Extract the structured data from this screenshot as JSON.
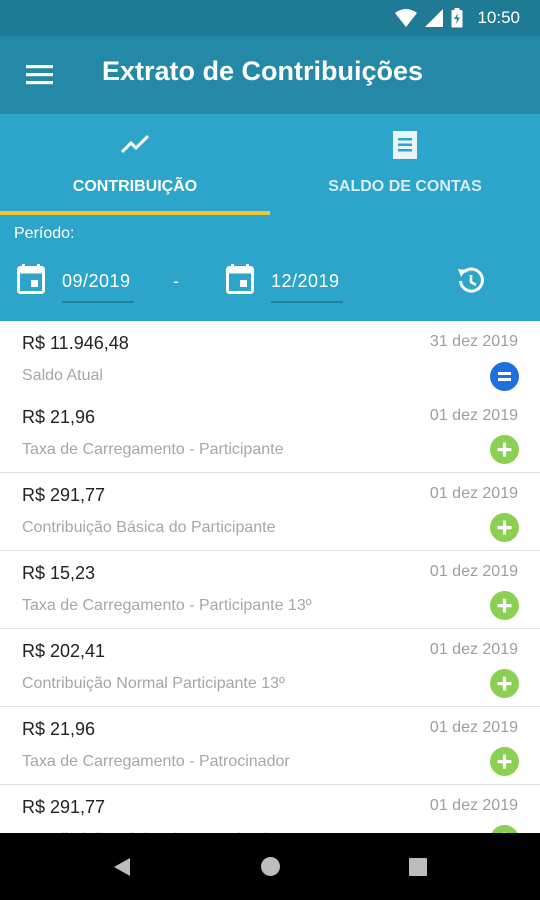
{
  "status_bar": {
    "time": "10:50"
  },
  "app_bar": {
    "title": "Extrato de Contribuições"
  },
  "tabs": [
    {
      "label": "CONTRIBUIÇÃO",
      "icon": "trending-line-icon",
      "active": true
    },
    {
      "label": "SALDO DE CONTAS",
      "icon": "receipt-icon",
      "active": false
    }
  ],
  "period": {
    "label": "Período:",
    "start": "09/2019",
    "separator": "-",
    "end": "12/2019"
  },
  "entries": [
    {
      "amount": "R$ 11.946,48",
      "date": "31 dez 2019",
      "description": "Saldo Atual",
      "icon": "equals-icon"
    },
    {
      "amount": "R$ 21,96",
      "date": "01 dez 2019",
      "description": "Taxa de Carregamento - Participante",
      "icon": "plus-icon"
    },
    {
      "amount": "R$ 291,77",
      "date": "01 dez 2019",
      "description": "Contribuição Básica do Participante",
      "icon": "plus-icon"
    },
    {
      "amount": "R$ 15,23",
      "date": "01 dez 2019",
      "description": "Taxa de Carregamento - Participante 13º",
      "icon": "plus-icon"
    },
    {
      "amount": "R$ 202,41",
      "date": "01 dez 2019",
      "description": "Contribuição Normal Participante 13º",
      "icon": "plus-icon"
    },
    {
      "amount": "R$ 21,96",
      "date": "01 dez 2019",
      "description": "Taxa de Carregamento - Patrocinador",
      "icon": "plus-icon"
    },
    {
      "amount": "R$ 291,77",
      "date": "01 dez 2019",
      "description": "Contribuição Básica do Patrocinador",
      "icon": "plus-icon"
    }
  ],
  "colors": {
    "status_bar": "#1f7b95",
    "app_bar": "#2389a6",
    "tab_bar": "#2da4c9",
    "tab_indicator": "#f1c232",
    "credit": "#8bd053",
    "balance": "#1e6fe0"
  }
}
